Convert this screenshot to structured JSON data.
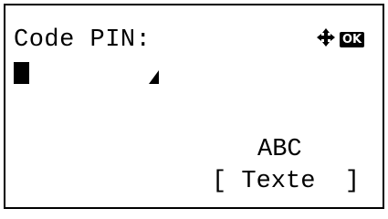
{
  "panel": {
    "title": "Code PIN:",
    "nav_icon": "four-way-arrow-icon",
    "ok_badge": "OK",
    "input_cursor_icon": "text-cursor-block-icon",
    "input_end_icon": "input-end-triangle-icon",
    "input_mode": "ABC",
    "softkey_label": "[ Texte  ]"
  }
}
